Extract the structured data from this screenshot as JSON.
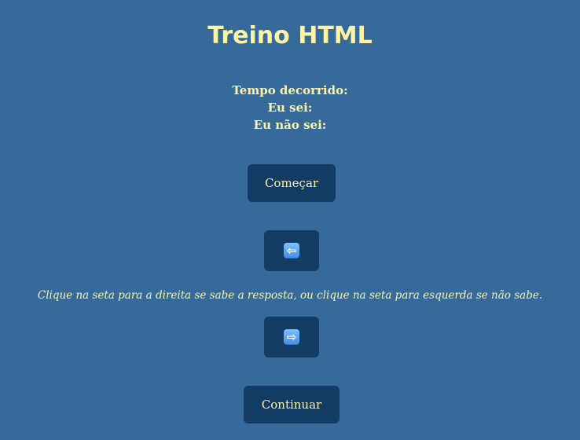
{
  "title": "Treino HTML",
  "stats": {
    "elapsed_label": "Tempo decorrido:",
    "know_label": "Eu sei:",
    "dont_know_label": "Eu não sei:"
  },
  "buttons": {
    "start_label": "Começar",
    "left_arrow": "⇦",
    "right_arrow": "⇨",
    "continue_label": "Continuar"
  },
  "instruction": "Clique na seta para a direita se sabe a resposta, ou clique na seta para esquerda se não sabe.",
  "colors": {
    "background": "#356a9a",
    "button": "#123c63",
    "text": "#fdf3a7",
    "arrow_key": "#4a9bef"
  }
}
